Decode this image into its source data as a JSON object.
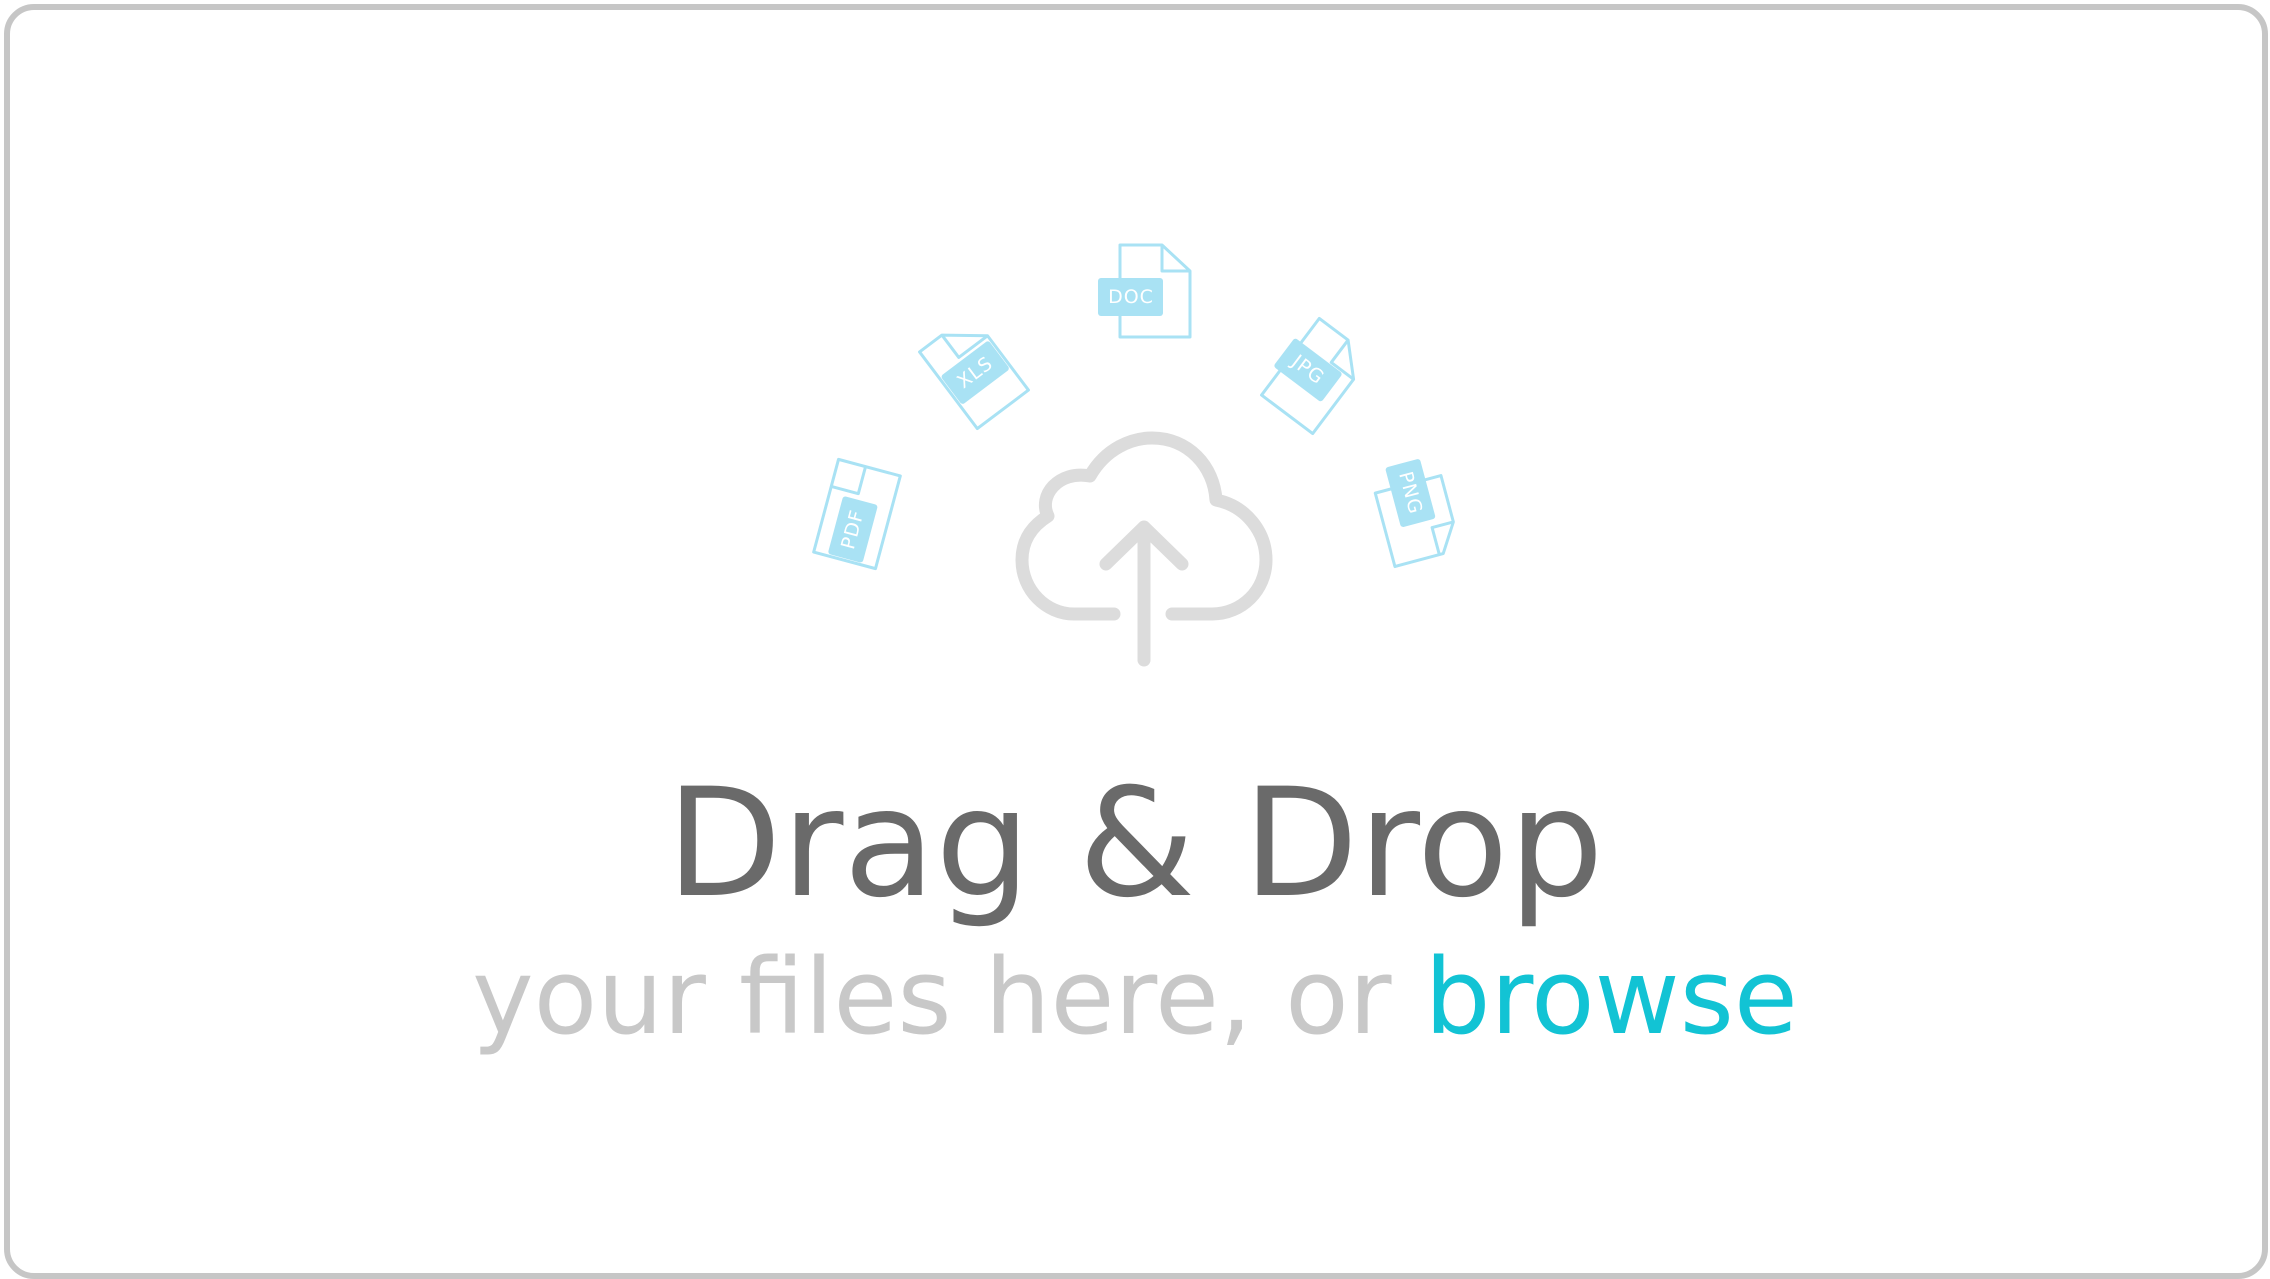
{
  "dropzone": {
    "title": "Drag & Drop",
    "subtitle_prefix": "your files here, or ",
    "browse_label": "browse"
  },
  "file_types": {
    "pdf": "PDF",
    "xls": "XLS",
    "doc": "DOC",
    "jpg": "JPG",
    "png": "PNG"
  },
  "icons": {
    "upload": "cloud-upload-icon"
  },
  "colors": {
    "border": "#c6c6c6",
    "file_icon": "#a9e2f4",
    "cloud": "#dcdcdc",
    "title": "#6a6a6a",
    "subtitle": "#c8c8c8",
    "link": "#12c3d4"
  }
}
